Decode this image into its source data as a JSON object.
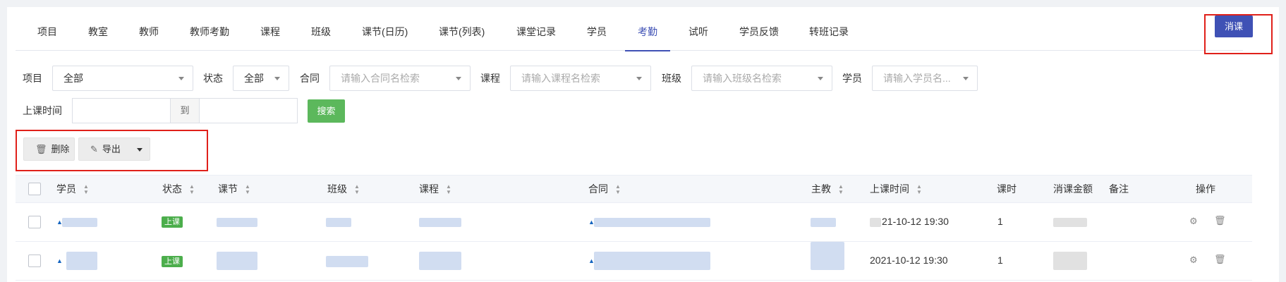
{
  "tabs": [
    {
      "label": "项目"
    },
    {
      "label": "教室"
    },
    {
      "label": "教师"
    },
    {
      "label": "教师考勤"
    },
    {
      "label": "课程"
    },
    {
      "label": "班级"
    },
    {
      "label": "课节(日历)"
    },
    {
      "label": "课节(列表)"
    },
    {
      "label": "课堂记录"
    },
    {
      "label": "学员"
    },
    {
      "label": "考勤"
    },
    {
      "label": "试听"
    },
    {
      "label": "学员反馈"
    },
    {
      "label": "转班记录"
    }
  ],
  "active_tab": "考勤",
  "xiaoke_button": "消课",
  "filters": {
    "project_label": "项目",
    "project_value": "全部",
    "status_label": "状态",
    "status_value": "全部",
    "contract_label": "合同",
    "contract_placeholder": "请输入合同名检索",
    "course_label": "课程",
    "course_placeholder": "请输入课程名检索",
    "class_label": "班级",
    "class_placeholder": "请输入班级名检索",
    "student_label": "学员",
    "student_placeholder": "请输入学员名...",
    "time_label": "上课时间",
    "time_sep": "到",
    "search_button": "搜索"
  },
  "toolbar": {
    "delete_label": "删除",
    "export_label": "导出"
  },
  "table": {
    "headers": {
      "student": "学员",
      "status": "状态",
      "lesson": "课节",
      "class": "班级",
      "course": "课程",
      "contract": "合同",
      "teacher": "主教",
      "time": "上课时间",
      "hours": "课时",
      "amount": "消课金额",
      "note": "备注",
      "actions": "操作"
    },
    "rows": [
      {
        "status": "上课",
        "time": "21-10-12 19:30",
        "hours": "1"
      },
      {
        "status": "上课",
        "time": "2021-10-12 19:30",
        "hours": "1"
      }
    ]
  },
  "colors": {
    "accent": "#3f51b5",
    "success": "#5cb85c",
    "highlight": "#e0201a"
  }
}
